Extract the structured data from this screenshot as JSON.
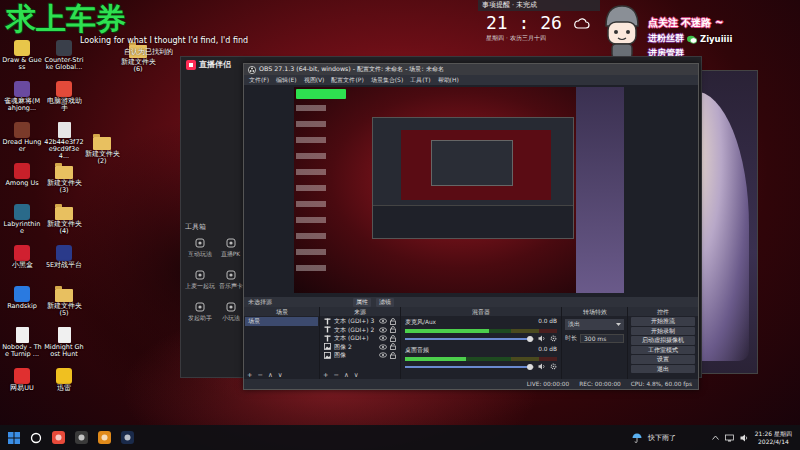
{
  "overlay": {
    "banner": "求上车券",
    "lyric_en": "Looking for what I thought I'd find, I'd find",
    "lyric_zh": "自认为已找到的"
  },
  "desktop_icons": [
    {
      "label": "Draw & Guess",
      "kind": "app",
      "color": "#e8c64a"
    },
    {
      "label": "Counter-Strike Global...",
      "kind": "app",
      "color": "#3a3f4a"
    },
    {
      "label": "雀魂麻将(Mahjong...",
      "kind": "app",
      "color": "#6a4aa0"
    },
    {
      "label": "电脑游戏助手",
      "kind": "app",
      "color": "#e34a3a"
    },
    {
      "label": "Dread Hunger",
      "kind": "app",
      "color": "#7a3a2a"
    },
    {
      "label": "42b44e3f72e9cd9f3e4...",
      "kind": "file",
      "color": "#e6e6e6"
    },
    {
      "label": "Among Us",
      "kind": "app",
      "color": "#c8202a"
    },
    {
      "label": "新建文件夹 (3)",
      "kind": "folder",
      "color": "#e8c060"
    },
    {
      "label": "Labyrinthine",
      "kind": "app",
      "color": "#2a6a8a"
    },
    {
      "label": "新建文件夹 (4)",
      "kind": "folder",
      "color": "#e8c060"
    },
    {
      "label": "小黑盒",
      "kind": "app",
      "color": "#d02030"
    },
    {
      "label": "5E对战平台",
      "kind": "app",
      "color": "#2a3a8a"
    },
    {
      "label": "Randskip",
      "kind": "app",
      "color": "#2a7ae0"
    },
    {
      "label": "新建文件夹 (5)",
      "kind": "folder",
      "color": "#e8c060"
    },
    {
      "label": "Nobody - The Turnip ...",
      "kind": "file",
      "color": "#f0f0f0"
    },
    {
      "label": "Midnight Ghost Hunt",
      "kind": "file",
      "color": "#f0f0f0"
    },
    {
      "label": "网易UU",
      "kind": "app",
      "color": "#e03030"
    },
    {
      "label": "迅雷",
      "kind": "app",
      "color": "#f0c020"
    }
  ],
  "loose_icons": [
    {
      "label": "新建文件夹 (6)",
      "kind": "folder",
      "color": "#e8c060"
    },
    {
      "label": "新建文件夹 (2)",
      "kind": "folder",
      "color": "#e8c060"
    }
  ],
  "clock_widget": {
    "header": "事项提醒 · 未完成",
    "time": "21 : 26",
    "date": "星期四 · 农历三月十四"
  },
  "sticker": {
    "follow": "点关注 不迷路 ~",
    "fan_group": "进粉丝群",
    "handle": "Ziyuiiii",
    "admin_group": "进房管群"
  },
  "companion": {
    "logo": "直播伴侣",
    "toolbox": "工具箱",
    "tools": [
      "互动玩法",
      "直播PK",
      "上麦一起玩",
      "音乐声卡",
      "发起助手",
      "小玩法"
    ]
  },
  "obs": {
    "title": "OBS 27.1.3 (64-bit, windows) - 配置文件: 未命名 - 场景: 未命名",
    "menu": [
      "文件(F)",
      "编辑(E)",
      "视图(V)",
      "配置文件(P)",
      "场景集合(S)",
      "工具(T)",
      "帮助(H)"
    ],
    "source_bar": {
      "label": "未选择源",
      "buttons": [
        "属性",
        "滤镜"
      ]
    },
    "docks": [
      "场景",
      "来源",
      "混音器",
      "转场特效",
      "控件"
    ],
    "scenes": [
      {
        "name": "场景",
        "selected": true
      }
    ],
    "scene_tools": [
      "+",
      "−",
      "∧",
      "∨"
    ],
    "sources": [
      {
        "name": "文本 (GDI+) 3",
        "kind": "text",
        "visible": true
      },
      {
        "name": "文本 (GDI+) 2",
        "kind": "text",
        "visible": true
      },
      {
        "name": "文本 (GDI+)",
        "kind": "text",
        "visible": true
      },
      {
        "name": "图像 2",
        "kind": "image",
        "visible": true
      },
      {
        "name": "图像",
        "kind": "image",
        "visible": true
      }
    ],
    "source_tools": [
      "+",
      "−",
      "∧",
      "∨"
    ],
    "mixer": [
      {
        "name": "麦克风/Aux",
        "reading": "0.0 dB",
        "level": 0.55,
        "fader": 0.97,
        "muted": false
      },
      {
        "name": "桌面音频",
        "reading": "0.0 dB",
        "level": 0.4,
        "fader": 0.97,
        "muted": false
      }
    ],
    "transition": {
      "selected": "淡出",
      "duration_label": "时长",
      "duration": "300 ms"
    },
    "controls": [
      "开始推流",
      "开始录制",
      "启动虚拟摄像机",
      "工作室模式",
      "设置",
      "退出"
    ],
    "status": [
      "LIVE: 00:00:00",
      "REC: 00:00:00",
      "CPU: 4.8%, 60.00 fps"
    ]
  },
  "taskbar": {
    "pinned": [
      {
        "kind": "start",
        "color": "#3a8ee6"
      },
      {
        "kind": "search",
        "color": "#ffffff"
      },
      {
        "kind": "app",
        "color": "#e84a3a"
      },
      {
        "kind": "app",
        "color": "#3a3a3a"
      },
      {
        "kind": "app",
        "color": "#e08a1a"
      },
      {
        "kind": "app",
        "color": "#1a2a4a"
      }
    ],
    "weather": "快下雨了",
    "time": "21:26 星期四",
    "date": "2022/4/14"
  }
}
